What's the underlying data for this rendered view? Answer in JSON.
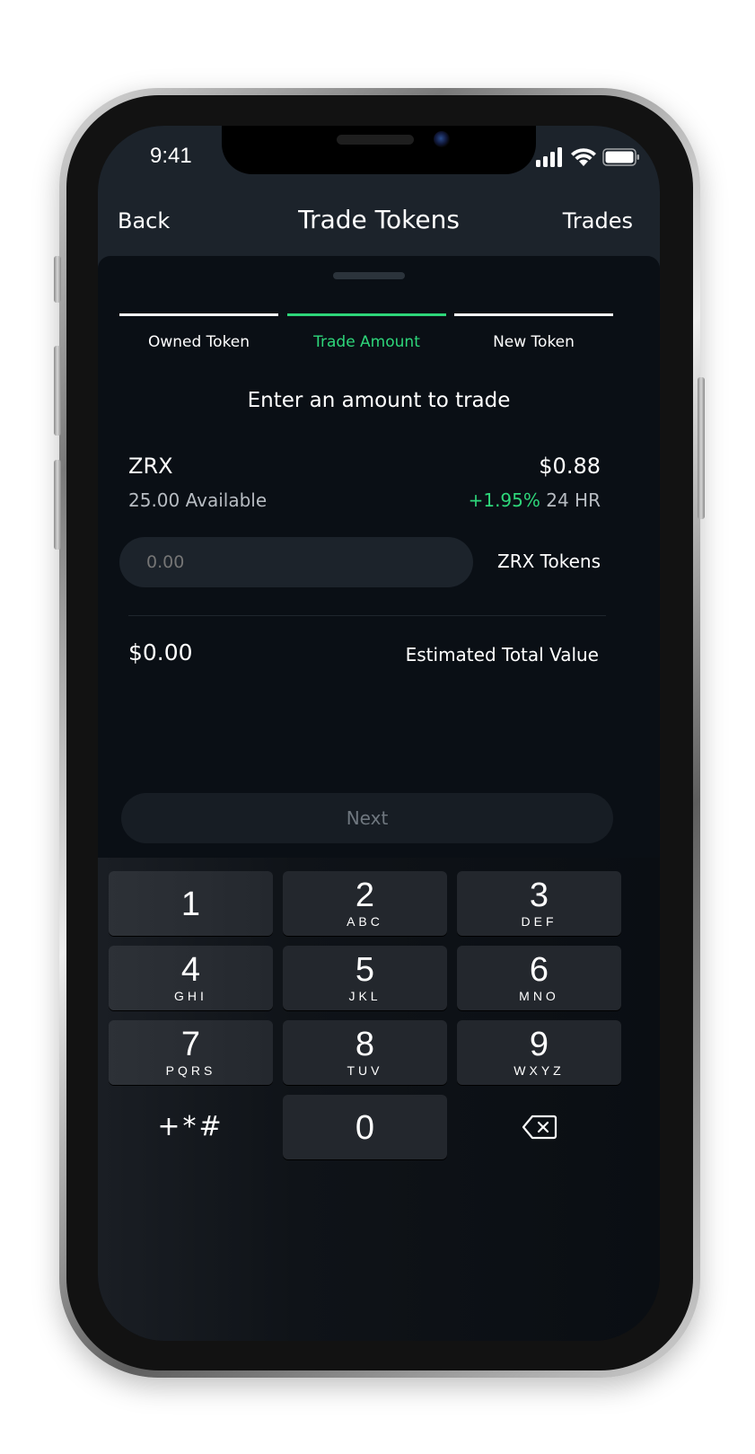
{
  "status_bar": {
    "time": "9:41",
    "icons": [
      "cellular-signal-icon",
      "wifi-icon",
      "battery-icon"
    ]
  },
  "nav": {
    "back_label": "Back",
    "title": "Trade Tokens",
    "trades_label": "Trades"
  },
  "steps": [
    {
      "label": "Owned Token",
      "active": false
    },
    {
      "label": "Trade Amount",
      "active": true
    },
    {
      "label": "New Token",
      "active": false
    }
  ],
  "prompt": "Enter an amount to trade",
  "token": {
    "symbol": "ZRX",
    "available": "25.00 Available",
    "price": "$0.88",
    "change": "+1.95%",
    "change_period": "24 HR"
  },
  "amount_input": {
    "placeholder": "0.00",
    "value": "",
    "unit": "ZRX Tokens"
  },
  "estimate": {
    "value": "$0.00",
    "label": "Estimated Total Value"
  },
  "next_button": {
    "label": "Next",
    "enabled": false
  },
  "keypad": {
    "keys": [
      {
        "digit": "1",
        "letters": ""
      },
      {
        "digit": "2",
        "letters": "ABC"
      },
      {
        "digit": "3",
        "letters": "DEF"
      },
      {
        "digit": "4",
        "letters": "GHI"
      },
      {
        "digit": "5",
        "letters": "JKL"
      },
      {
        "digit": "6",
        "letters": "MNO"
      },
      {
        "digit": "7",
        "letters": "PQRS"
      },
      {
        "digit": "8",
        "letters": "TUV"
      },
      {
        "digit": "9",
        "letters": "WXYZ"
      }
    ],
    "symbols_label": "+*#",
    "zero": "0",
    "delete_icon": "backspace-icon"
  },
  "colors": {
    "accent_green": "#2ed67a",
    "background": "#0a0f15",
    "header": "#1c232b"
  }
}
